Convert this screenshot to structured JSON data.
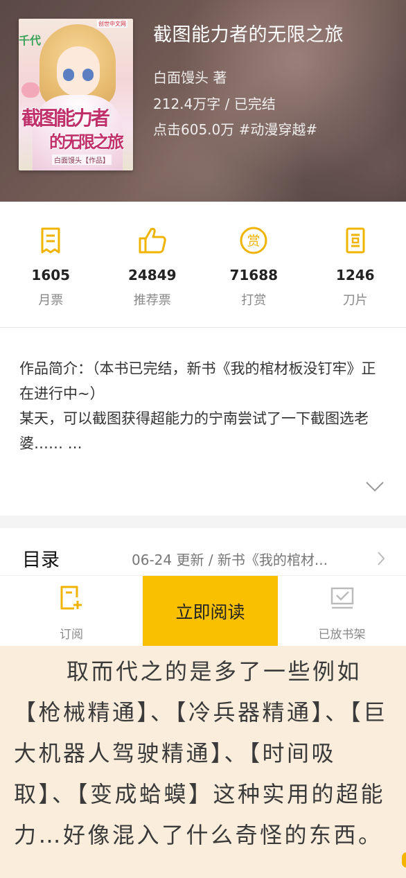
{
  "book": {
    "title": "截图能力者的无限之旅",
    "author": "白面馒头 著",
    "stats": "212.4万字 / 已完结",
    "clicks": "点击605.0万 #动漫穿越#"
  },
  "cover": {
    "top_tag": "千代",
    "publisher": "创世中文网",
    "title_line1": "截图能力者",
    "title_line2": "的无限之旅",
    "author_tag": "白面馒头【作品】"
  },
  "metrics": [
    {
      "value": "1605",
      "label": "月票",
      "icon": "monthly-ticket-icon"
    },
    {
      "value": "24849",
      "label": "推荐票",
      "icon": "thumbs-up-icon"
    },
    {
      "value": "71688",
      "label": "打赏",
      "icon": "reward-coin-icon"
    },
    {
      "value": "1246",
      "label": "刀片",
      "icon": "blade-icon"
    }
  ],
  "intro": {
    "text": "作品简介：（本书已完结，新书《我的棺材板没钉牢》正在进行中~）\n某天，可以截图获得超能力的宁南尝试了一下截图选老婆…… …"
  },
  "toc": {
    "label": "目录",
    "update": "06-24 更新 / 新书《我的棺材..."
  },
  "bottom_bar": {
    "subscribe_label": "订阅",
    "read_label": "立即阅读",
    "shelf_label": "已放书架"
  },
  "excerpt": {
    "text": "取而代之的是多了一些例如【枪械精通】、【冷兵器精通】、【巨大机器人驾驶精通】、【时间吸取】、【变成蛤蟆】这种实用的超能力…好像混入了什么奇怪的东西。"
  },
  "colors": {
    "accent": "#f8c000",
    "icon": "#f0b400",
    "excerpt_bg": "#faeddc"
  }
}
